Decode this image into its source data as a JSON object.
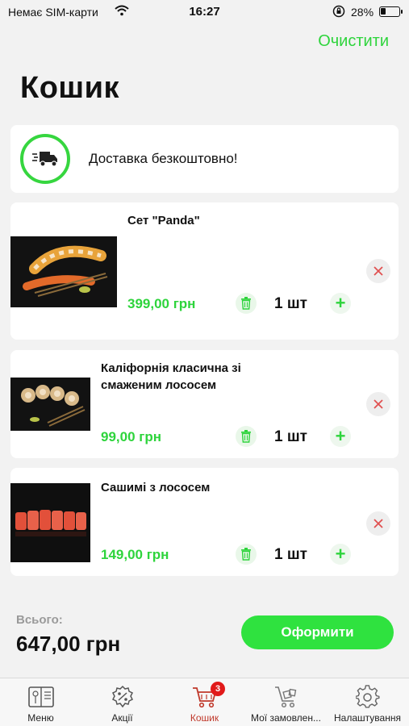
{
  "status_bar": {
    "carrier": "Немає SIM-карти",
    "time": "16:27",
    "battery": "28%"
  },
  "header": {
    "clear_label": "Очистити",
    "title": "Кошик"
  },
  "delivery": {
    "text": "Доставка безкоштовно!",
    "icon": "truck-icon"
  },
  "cart": {
    "items": [
      {
        "name": "Сет \"Panda\"",
        "price": "399,00 грн",
        "quantity": "1 шт"
      },
      {
        "name": "Каліфорнія класична зі смаженим лососем",
        "price": "99,00 грн",
        "quantity": "1 шт"
      },
      {
        "name": "Сашимі з лососем",
        "price": "149,00 грн",
        "quantity": "1 шт"
      }
    ]
  },
  "summary": {
    "total_label": "Всього:",
    "total_value": "647,00 грн",
    "checkout_label": "Оформити"
  },
  "tabs": [
    {
      "label": "Меню",
      "icon": "menu-book-icon"
    },
    {
      "label": "Акції",
      "icon": "discount-badge-icon"
    },
    {
      "label": "Кошик",
      "icon": "cart-icon",
      "badge": "3"
    },
    {
      "label": "Мої замовлен...",
      "icon": "orders-cart-icon"
    },
    {
      "label": "Налаштування",
      "icon": "gear-icon"
    }
  ],
  "colors": {
    "accent": "#2ed43c",
    "active_tab": "#c0392b",
    "badge": "#e11a1a"
  }
}
